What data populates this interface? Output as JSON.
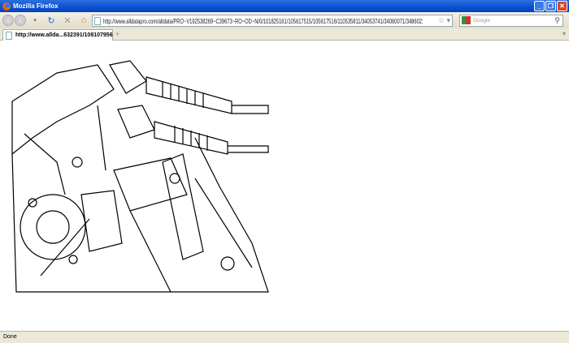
{
  "window": {
    "title": "Mozilla Firefox"
  },
  "toolbar": {
    "url": "http://www.alldatapro.com/alldata/PRO~V192538269~C39673~RO~OD~N/0/101825161/105617515/105617516/110535811/34053741/34060071/348602:",
    "search_placeholder": "Google"
  },
  "tabs": [
    {
      "label": "http://www.allda...632391/108107956"
    }
  ],
  "status": {
    "text": "Done"
  },
  "colors": {
    "titlebar": "#0a4fd0",
    "chrome": "#ebe8d8"
  }
}
